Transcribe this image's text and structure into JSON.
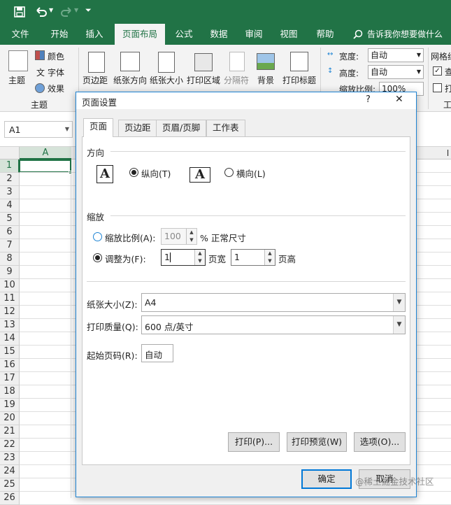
{
  "qat": {
    "save_icon": "save-icon",
    "undo_icon": "undo-icon",
    "redo_icon": "redo-icon",
    "customize_icon": "customize-icon"
  },
  "tabs": [
    "文件",
    "开始",
    "插入",
    "页面布局",
    "公式",
    "数据",
    "审阅",
    "视图",
    "帮助"
  ],
  "tell_me": "告诉我你想要做什么",
  "ribbon": {
    "theme_label": "主题",
    "colors": "颜色",
    "fonts": "字体",
    "effects": "效果",
    "group_theme": "主题",
    "margins": "页边距",
    "orientation": "纸张方向",
    "size": "纸张大小",
    "print_area": "打印区域",
    "breaks": "分隔符",
    "background": "背景",
    "print_titles": "打印标题",
    "width_label": "宽度:",
    "width_value": "自动",
    "height_label": "高度:",
    "height_value": "自动",
    "scale_label": "缩放比例:",
    "scale_value": "100%",
    "gridlines": "网格线",
    "view": "查",
    "print": "打",
    "group_sheet": "工"
  },
  "namebox": "A1",
  "column_a": "A",
  "column_i": "I",
  "rows": [
    "1",
    "2",
    "3",
    "4",
    "5",
    "6",
    "7",
    "8",
    "9",
    "10",
    "11",
    "12",
    "13",
    "14",
    "15",
    "16",
    "17",
    "18",
    "19",
    "20",
    "21",
    "22",
    "23",
    "24",
    "25",
    "26"
  ],
  "dialog": {
    "title": "页面设置",
    "help": "?",
    "close": "✕",
    "tabs": [
      "页面",
      "页边距",
      "页眉/页脚",
      "工作表"
    ],
    "orientation_section": "方向",
    "portrait": "纵向(T)",
    "landscape": "横向(L)",
    "orientation_glyph": "A",
    "scaling_section": "缩放",
    "adjust_to": "缩放比例(A):",
    "adjust_value": "100",
    "normal_size": "% 正常尺寸",
    "fit_to": "调整为(F):",
    "fit_wide_value": "1",
    "pages_wide": "页宽",
    "fit_tall_value": "1",
    "pages_tall": "页高",
    "paper_size_label": "纸张大小(Z):",
    "paper_size_value": "A4",
    "print_quality_label": "打印质量(Q):",
    "print_quality_value": "600 点/英寸",
    "first_page_label": "起始页码(R):",
    "first_page_value": "自动",
    "print_button": "打印(P)...",
    "preview_button": "打印预览(W)",
    "options_button": "选项(O)...",
    "ok_button": "确定",
    "cancel_button": "取消"
  },
  "watermark": "@稀土掘金技术社区",
  "colors": {
    "excel_green": "#217346",
    "dialog_border": "#1e84d4",
    "selection": "#217346"
  }
}
